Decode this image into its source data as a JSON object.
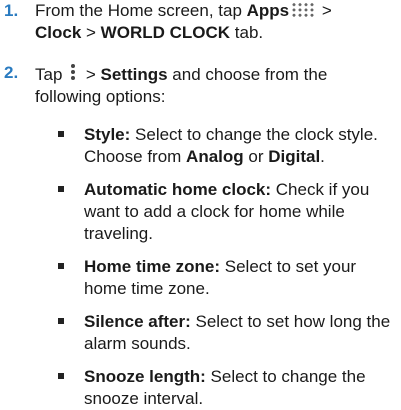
{
  "step1": {
    "number": "1.",
    "text_before_apps": "From the Home screen, tap ",
    "apps_label": "Apps",
    "icon": "apps-grid-icon",
    "gt1": " >",
    "clock_label": "Clock",
    "gt2": " > ",
    "world_clock_label": "WORLD CLOCK",
    "tab_suffix": " tab."
  },
  "step2": {
    "number": "2.",
    "tap": "Tap ",
    "icon": "overflow-menu-icon",
    "gt": " > ",
    "settings_label": "Settings",
    "rest": " and choose from the following options:"
  },
  "options": [
    {
      "label": "Style:",
      "text_a": " Select to change the clock style. Choose from ",
      "strong1": "Analog",
      "text_b": " or ",
      "strong2": "Digital",
      "text_c": "."
    },
    {
      "label": "Automatic home clock:",
      "text": " Check if you want to add a clock for home while traveling."
    },
    {
      "label": "Home time zone:",
      "text": " Select to set your home time zone."
    },
    {
      "label": "Silence after:",
      "text": " Select to set how long the alarm sounds."
    },
    {
      "label": "Snooze length:",
      "text": " Select to change the snooze interval."
    }
  ]
}
